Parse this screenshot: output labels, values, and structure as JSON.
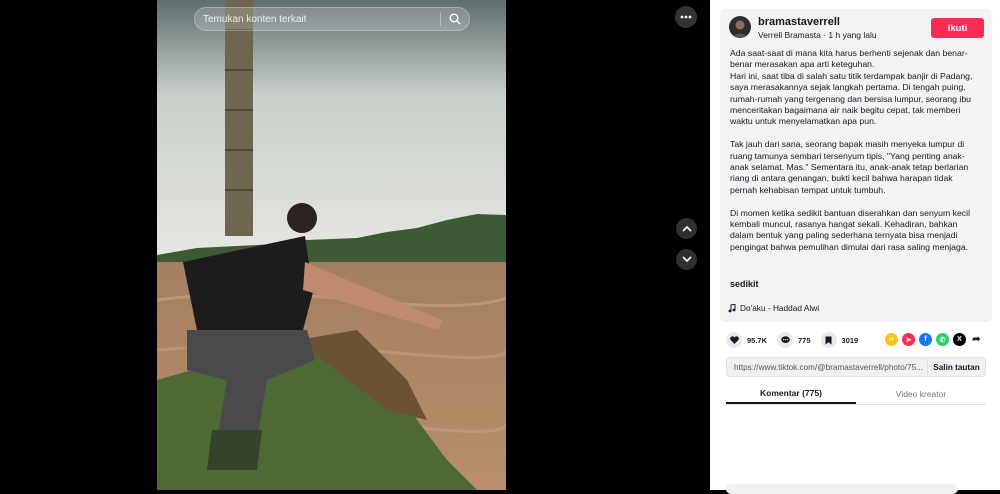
{
  "search": {
    "placeholder": "Temukan konten terkait"
  },
  "post": {
    "username": "bramastaverrell",
    "display_name": "Verrell Bramasta",
    "time_ago": "1 h yang lalu",
    "follow_label": "Ikuti",
    "caption": [
      "Ada saat-saat di mana kita harus berhenti sejenak dan benar-\nbenar merasakan apa arti keteguhan.\nHari ini, saat tiba di salah satu titik terdampak banjir di Padang,\nsaya merasakannya sejak langkah pertama. Di tengah puing,\nrumah-rumah yang tergenang dan bersisa lumpur, seorang ibu\nmenceritakan bagaimana air naik begitu cepat, tak memberi\nwaktu untuk menyelamatkan apa pun.",
      "Tak jauh dari sana, seorang bapak masih menyeka lumpur di\nruang tamunya sembari tersenyum tipis, \"Yang penting anak-\nanak selamat, Mas.\" Sementara itu, anak-anak tetap berlarian\nriang di antara genangan, bukti kecil bahwa harapan tidak\npernah kehabisan tempat untuk tumbuh.",
      "Di momen ketika sedikit bantuan diserahkan dan senyum kecil\nkembali muncul, rasanya hangat sekali. Kehadiran, bahkan\ndalam bentuk yang paling sederhana ternyata bisa menjadi\npengingat bahwa pemulihan dimulai dari rasa saling menjaga."
    ],
    "more_label": "sedikit",
    "music": "Do'aku - Haddad Alwi"
  },
  "stats": {
    "likes": "95.7K",
    "comments": "775",
    "saves": "3019"
  },
  "share_icons": [
    {
      "name": "embed",
      "color": "#f5c518",
      "glyph": "</>"
    },
    {
      "name": "send",
      "color": "#fe2c55",
      "glyph": "➤"
    },
    {
      "name": "facebook",
      "color": "#1877f2",
      "glyph": "f"
    },
    {
      "name": "whatsapp",
      "color": "#25d366",
      "glyph": "✆"
    },
    {
      "name": "x",
      "color": "#000000",
      "glyph": "X"
    },
    {
      "name": "share",
      "color": "#ffffff",
      "glyph": "➦"
    }
  ],
  "link": {
    "url": "https://www.tiktok.com/@bramastaverrell/photo/75...",
    "copy_label": "Salin tautan"
  },
  "tabs": {
    "comments": "Komentar (775)",
    "creator_videos": "Video kreator"
  },
  "colors": {
    "accent": "#fe2c55"
  }
}
